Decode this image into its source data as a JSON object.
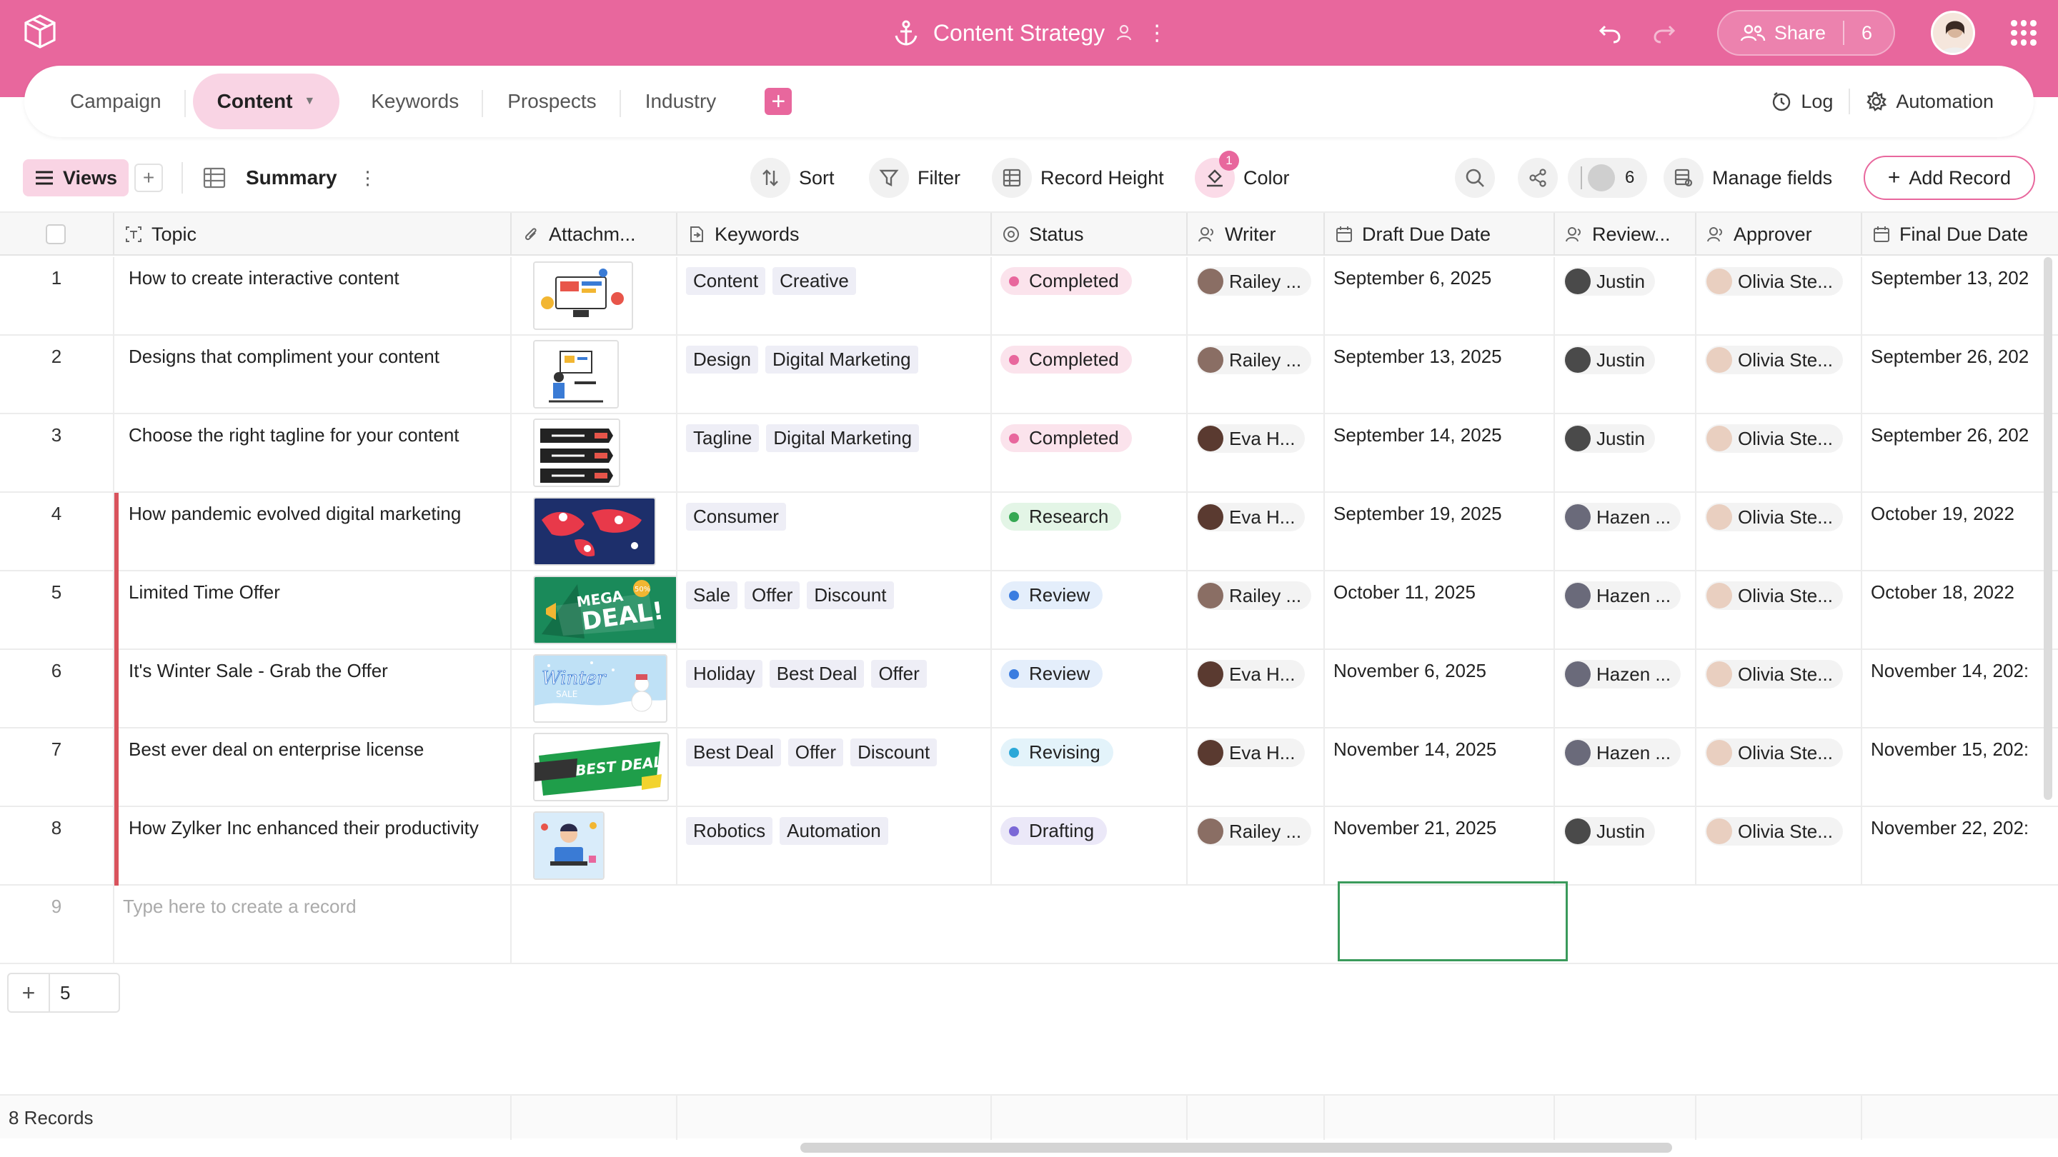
{
  "app": {
    "title": "Content Strategy",
    "share_label": "Share",
    "share_count": "6",
    "colors": {
      "brand": "#e8679d",
      "brand_light": "#f9d4e4"
    }
  },
  "tabs": [
    {
      "label": "Campaign",
      "active": false
    },
    {
      "label": "Content",
      "active": true
    },
    {
      "label": "Keywords",
      "active": false
    },
    {
      "label": "Prospects",
      "active": false
    },
    {
      "label": "Industry",
      "active": false
    }
  ],
  "tabs_right": {
    "log": "Log",
    "automation": "Automation"
  },
  "toolbar": {
    "views": "Views",
    "view_name": "Summary",
    "sort": "Sort",
    "filter": "Filter",
    "record_height": "Record Height",
    "color": "Color",
    "color_badge": "1",
    "collaborators": "6",
    "manage_fields": "Manage fields",
    "add_record": "Add Record"
  },
  "columns": [
    "Topic",
    "Attachm...",
    "Keywords",
    "Status",
    "Writer",
    "Draft Due Date",
    "Review...",
    "Approver",
    "Final Due Date"
  ],
  "rows": [
    {
      "num": "1",
      "topic": "How to create interactive content",
      "flag": false,
      "keywords": [
        "Content",
        "Creative"
      ],
      "status": "Completed",
      "writer": "Railey ...",
      "draft": "September 6, 2025",
      "reviewer": "Justin",
      "approver": "Olivia Ste...",
      "final": "September 13, 202"
    },
    {
      "num": "2",
      "topic": "Designs that compliment your content",
      "flag": false,
      "keywords": [
        "Design",
        "Digital Marketing"
      ],
      "status": "Completed",
      "writer": "Railey ...",
      "draft": "September 13, 2025",
      "reviewer": "Justin",
      "approver": "Olivia Ste...",
      "final": "September 26, 202"
    },
    {
      "num": "3",
      "topic": "Choose the right tagline for your content",
      "flag": false,
      "keywords": [
        "Tagline",
        "Digital Marketing"
      ],
      "status": "Completed",
      "writer": "Eva H...",
      "draft": "September 14, 2025",
      "reviewer": "Justin",
      "approver": "Olivia Ste...",
      "final": "September 26, 202"
    },
    {
      "num": "4",
      "topic": "How pandemic evolved digital marketing",
      "flag": true,
      "keywords": [
        "Consumer"
      ],
      "status": "Research",
      "writer": "Eva H...",
      "draft": "September 19, 2025",
      "reviewer": "Hazen ...",
      "approver": "Olivia Ste...",
      "final": "October 19, 2022"
    },
    {
      "num": "5",
      "topic": "Limited Time Offer",
      "flag": true,
      "keywords": [
        "Sale",
        "Offer",
        "Discount"
      ],
      "status": "Review",
      "writer": "Railey ...",
      "draft": "October 11, 2025",
      "reviewer": "Hazen ...",
      "approver": "Olivia Ste...",
      "final": "October 18, 2022"
    },
    {
      "num": "6",
      "topic": "It's Winter Sale - Grab the Offer",
      "flag": true,
      "keywords": [
        "Holiday",
        "Best Deal",
        "Offer"
      ],
      "status": "Review",
      "writer": "Eva H...",
      "draft": "November 6, 2025",
      "reviewer": "Hazen ...",
      "approver": "Olivia Ste...",
      "final": "November 14, 202:"
    },
    {
      "num": "7",
      "topic": "Best ever deal on enterprise license",
      "flag": true,
      "keywords": [
        "Best Deal",
        "Offer",
        "Discount"
      ],
      "status": "Revising",
      "writer": "Eva H...",
      "draft": "November 14, 2025",
      "reviewer": "Hazen ...",
      "approver": "Olivia Ste...",
      "final": "November 15, 202:"
    },
    {
      "num": "8",
      "topic": "How Zylker Inc enhanced their productivity",
      "flag": true,
      "keywords": [
        "Robotics",
        "Automation"
      ],
      "status": "Drafting",
      "writer": "Railey ...",
      "draft": "November 21, 2025",
      "reviewer": "Justin",
      "approver": "Olivia Ste...",
      "final": "November 22, 202:"
    }
  ],
  "attachments": {
    "thumb_5_line1": "MEGA",
    "thumb_5_line2": "DEAL!",
    "thumb_5_badge": "50%",
    "thumb_6_line1": "Winter",
    "thumb_6_line2": "SALE",
    "thumb_7_text": "BEST DEALS"
  },
  "status_colors": {
    "Completed": {
      "bg": "#fbe3ec",
      "dot": "#e8679d"
    },
    "Research": {
      "bg": "#e3f5e6",
      "dot": "#35a853"
    },
    "Review": {
      "bg": "#e4eefb",
      "dot": "#3b7de0"
    },
    "Revising": {
      "bg": "#e3f3fa",
      "dot": "#2ba8d8"
    },
    "Drafting": {
      "bg": "#ebe8f8",
      "dot": "#7b68d6"
    }
  },
  "new_row": {
    "num": "9",
    "placeholder": "Type here to create a record"
  },
  "add_row_count": "5",
  "footer": {
    "records": "8 Records"
  }
}
